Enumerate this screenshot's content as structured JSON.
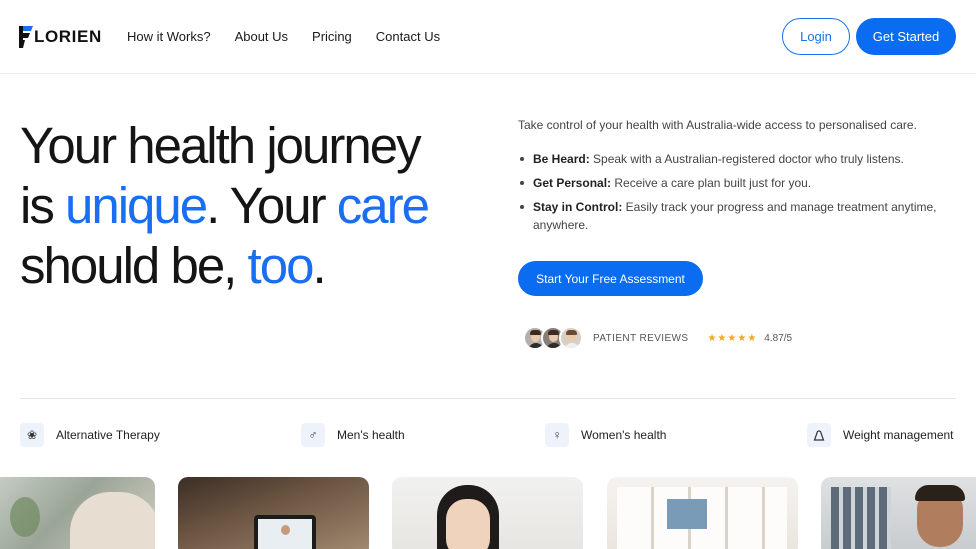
{
  "header": {
    "brand": "LORIEN",
    "nav": [
      "How it Works?",
      "About Us",
      "Pricing",
      "Contact Us"
    ],
    "login_label": "Login",
    "get_started_label": "Get Started"
  },
  "hero": {
    "title_l1": "Your health journey",
    "title_l2a": "is ",
    "title_l2b": "unique",
    "title_l2c": ". Your ",
    "title_l2d": "care",
    "title_l3a": "should be, ",
    "title_l3b": "too",
    "title_l3c": ".",
    "intro": "Take control of your health with Australia-wide access to personalised care.",
    "bullets": [
      {
        "bold": "Be Heard:",
        "text": " Speak with a Australian-registered doctor who truly listens."
      },
      {
        "bold": "Get Personal:",
        "text": " Receive a care plan built just for you."
      },
      {
        "bold": "Stay in Control:",
        "text": " Easily track your progress and manage treatment anytime, anywhere."
      }
    ],
    "cta_label": "Start Your Free Assessment",
    "reviews_label": "PATIENT REVIEWS",
    "stars": "★★★★★",
    "rating": "4.87/5"
  },
  "categories": [
    {
      "label": "Alternative Therapy",
      "icon": "flower-icon"
    },
    {
      "label": "Men's health",
      "icon": "male-symbol-icon"
    },
    {
      "label": "Women's health",
      "icon": "female-symbol-icon"
    },
    {
      "label": "Weight management",
      "icon": "weight-icon"
    }
  ],
  "colors": {
    "accent": "#0a6cf0",
    "highlight": "#1a6ef0",
    "star": "#f5a623"
  }
}
